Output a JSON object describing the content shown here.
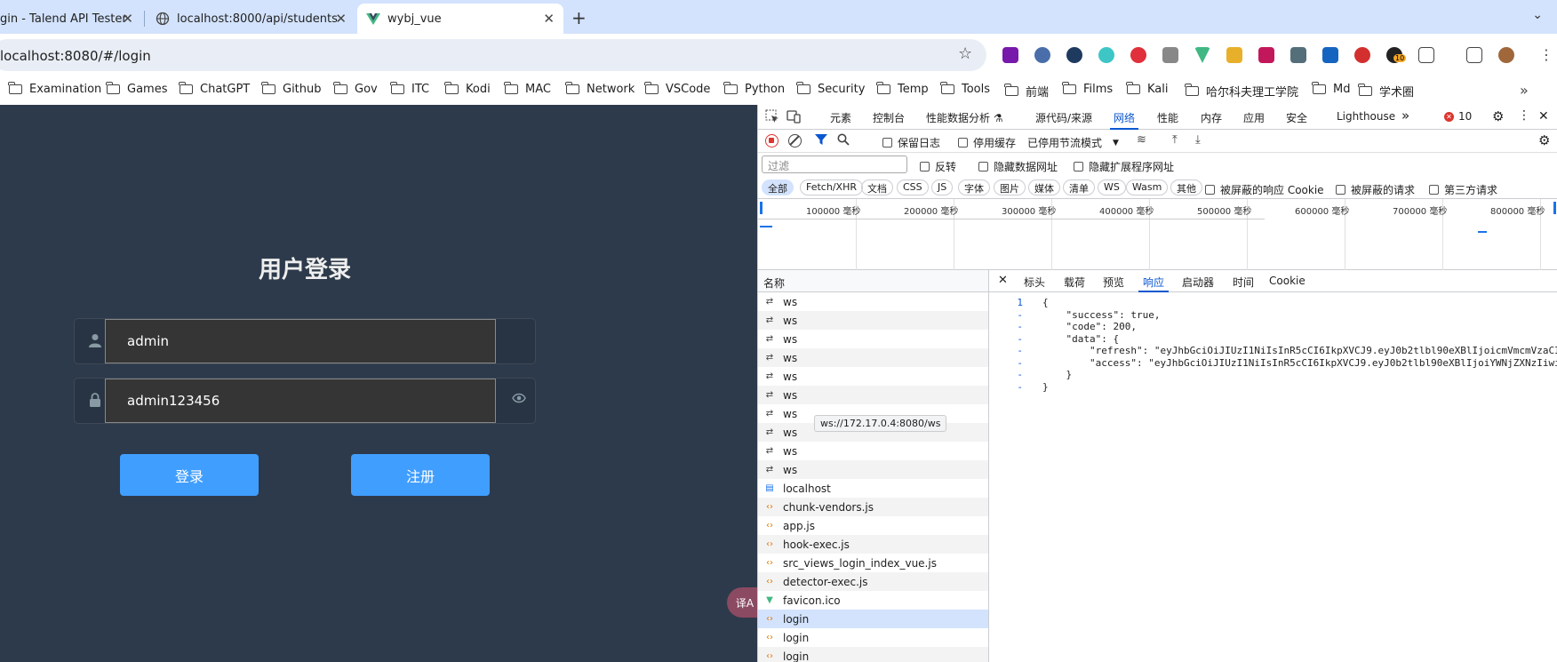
{
  "browser": {
    "tabs": [
      {
        "title": "gin - Talend API Tester"
      },
      {
        "title": "localhost:8000/api/students"
      },
      {
        "title": "wybj_vue"
      }
    ],
    "url": "localhost:8080/#/login",
    "bookmarks": [
      "Examination",
      "Games",
      "ChatGPT",
      "Github",
      "Gov",
      "ITC",
      "Kodi",
      "MAC",
      "Network",
      "VSCode",
      "Python",
      "Security",
      "Temp",
      "Tools",
      "前端",
      "Films",
      "Kali",
      "哈尔科夫理工学院",
      "Md",
      "学术圈"
    ],
    "extension_badge": "10"
  },
  "page": {
    "title": "用户登录",
    "username": "admin",
    "password": "admin123456",
    "login_button": "登录",
    "register_button": "注册",
    "translate_label": "译A"
  },
  "devtools": {
    "tabs": [
      "元素",
      "控制台",
      "性能数据分析 ⚗",
      "源代码/来源",
      "网络",
      "性能",
      "内存",
      "应用",
      "安全",
      "Lighthouse"
    ],
    "error_count": "10",
    "toolbar": {
      "preserve_log": "保留日志",
      "disable_cache": "停用缓存",
      "throttle": "已停用节流模式"
    },
    "filter": {
      "placeholder": "过滤",
      "invert": "反转",
      "hide_data_urls": "隐藏数据网址",
      "hide_ext_urls": "隐藏扩展程序网址"
    },
    "type_filters": [
      "全部",
      "Fetch/XHR",
      "文档",
      "CSS",
      "JS",
      "字体",
      "图片",
      "媒体",
      "清单",
      "WS",
      "Wasm",
      "其他"
    ],
    "blocked_cookies": "被屏蔽的响应 Cookie",
    "blocked_requests": "被屏蔽的请求",
    "third_party": "第三方请求",
    "timeline_labels": [
      "100000 毫秒",
      "200000 毫秒",
      "300000 毫秒",
      "400000 毫秒",
      "500000 毫秒",
      "600000 毫秒",
      "700000 毫秒",
      "800000 毫秒"
    ],
    "name_header": "名称",
    "requests": [
      {
        "name": "ws",
        "icon": "ws"
      },
      {
        "name": "ws",
        "icon": "ws"
      },
      {
        "name": "ws",
        "icon": "ws"
      },
      {
        "name": "ws",
        "icon": "ws"
      },
      {
        "name": "ws",
        "icon": "ws"
      },
      {
        "name": "ws",
        "icon": "ws"
      },
      {
        "name": "ws",
        "icon": "ws"
      },
      {
        "name": "ws",
        "icon": "ws"
      },
      {
        "name": "ws",
        "icon": "ws"
      },
      {
        "name": "ws",
        "icon": "ws"
      },
      {
        "name": "localhost",
        "icon": "doc"
      },
      {
        "name": "chunk-vendors.js",
        "icon": "script"
      },
      {
        "name": "app.js",
        "icon": "script"
      },
      {
        "name": "hook-exec.js",
        "icon": "script"
      },
      {
        "name": "src_views_login_index_vue.js",
        "icon": "script"
      },
      {
        "name": "detector-exec.js",
        "icon": "script"
      },
      {
        "name": "favicon.ico",
        "icon": "vue"
      },
      {
        "name": "login",
        "icon": "fetch"
      },
      {
        "name": "login",
        "icon": "fetch"
      },
      {
        "name": "login",
        "icon": "fetch"
      }
    ],
    "tooltip": "ws://172.17.0.4:8080/ws",
    "detail_tabs": [
      "标头",
      "载荷",
      "预览",
      "响应",
      "启动器",
      "时间",
      "Cookie"
    ],
    "response_lines": [
      {
        "ln": "1",
        "text": "{"
      },
      {
        "ln": "-",
        "text": "    \"success\": true,"
      },
      {
        "ln": "-",
        "text": "    \"code\": 200,"
      },
      {
        "ln": "-",
        "text": "    \"data\": {"
      },
      {
        "ln": "-",
        "text": "        \"refresh\": \"eyJhbGciOiJIUzI1NiIsInR5cCI6IkpXVCJ9.eyJ0b2tlbl90eXBlIjoicmVmcmVzaCI"
      },
      {
        "ln": "-",
        "text": "        \"access\": \"eyJhbGciOiJIUzI1NiIsInR5cCI6IkpXVCJ9.eyJ0b2tlbl90eXBlIjoiYWNjZXNzIiwi"
      },
      {
        "ln": "-",
        "text": "    }"
      },
      {
        "ln": "-",
        "text": "}"
      }
    ]
  }
}
